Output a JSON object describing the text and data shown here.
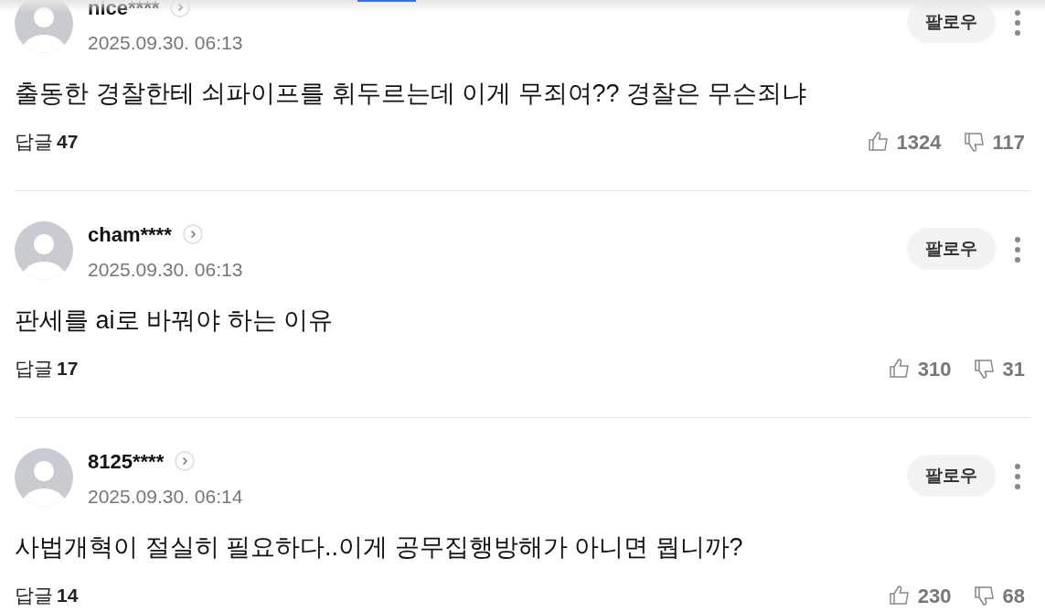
{
  "comments": [
    {
      "author": "nice****",
      "date": "2025.09.30. 06:13",
      "follow": "팔로우",
      "text": "출동한 경찰한테 쇠파이프를 휘두르는데 이게 무죄여?? 경찰은 무슨죄냐",
      "reply_label": "답글",
      "reply_count": "47",
      "likes": "1324",
      "dislikes": "117"
    },
    {
      "author": "cham****",
      "date": "2025.09.30. 06:13",
      "follow": "팔로우",
      "text": "판세를 ai로 바꿔야 하는 이유",
      "reply_label": "답글",
      "reply_count": "17",
      "likes": "310",
      "dislikes": "31"
    },
    {
      "author": "8125****",
      "date": "2025.09.30. 06:14",
      "follow": "팔로우",
      "text": "사법개혁이 절실히 필요하다..이게 공무집행방해가 아니면 뭡니까?",
      "reply_label": "답글",
      "reply_count": "14",
      "likes": "230",
      "dislikes": "68"
    }
  ]
}
